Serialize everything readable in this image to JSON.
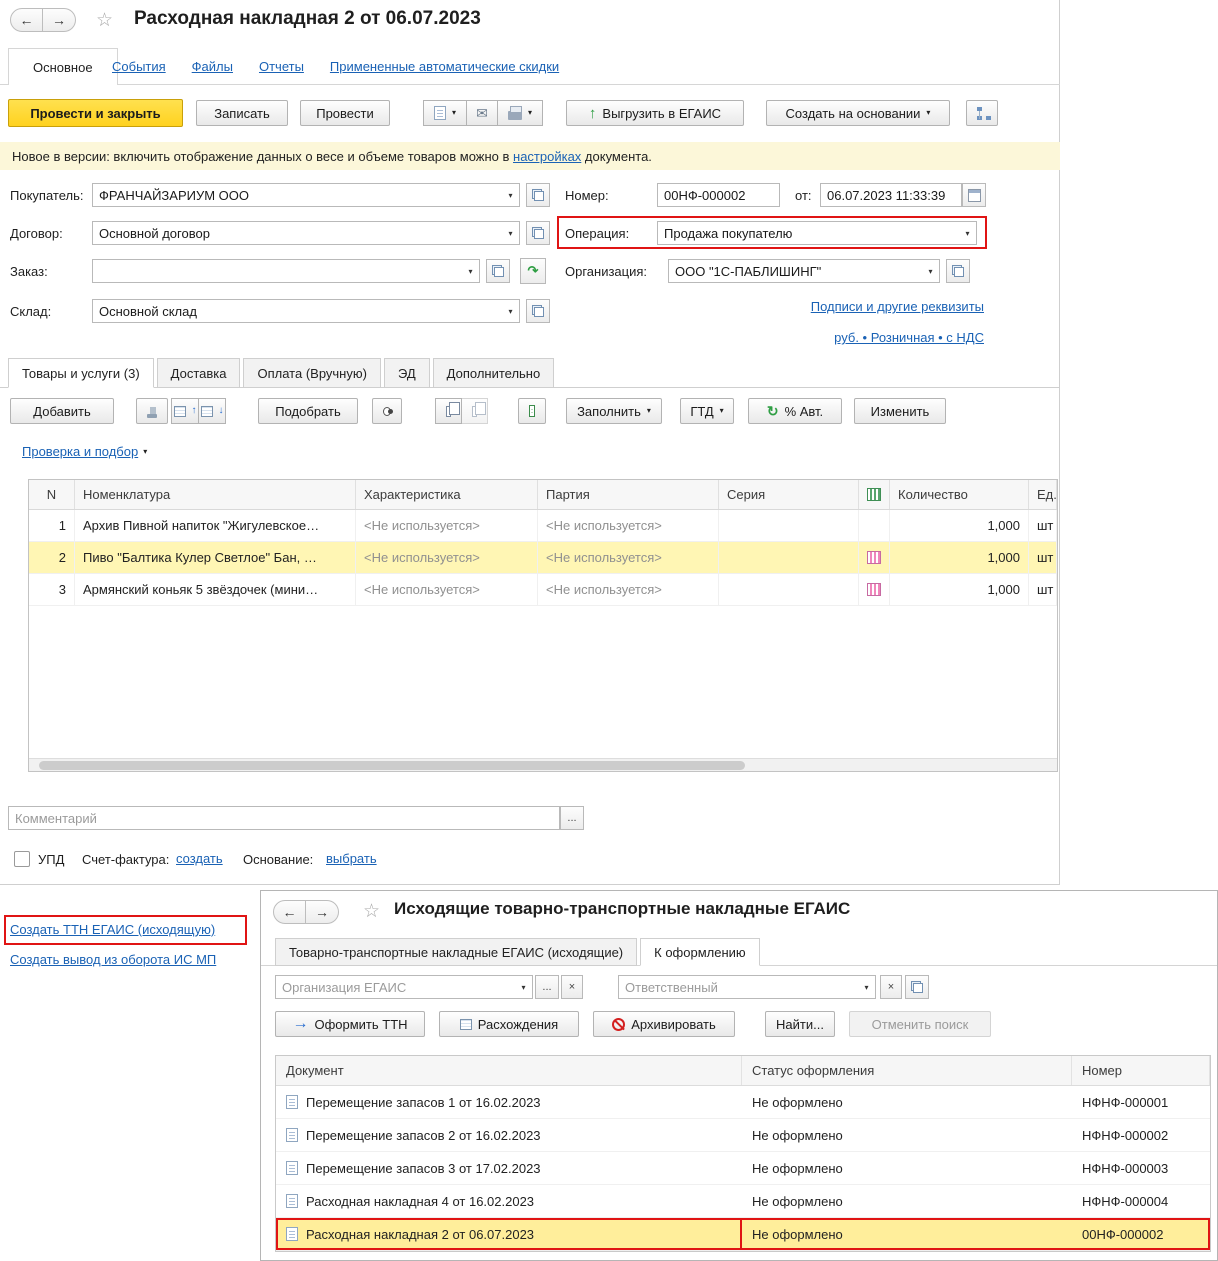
{
  "glyphs": {
    "back": "←",
    "forward": "→",
    "star": "☆",
    "caret": "▾",
    "dots": "...",
    "clear": "×",
    "up_arrow": "↑",
    "right_arrow": "→",
    "refresh": "↻",
    "envelope": "✉",
    "up_small": "↑",
    "down_small": "↓",
    "green_arrow": "↷"
  },
  "colors": {
    "highlight_red": "#e01414",
    "selected_goods_row": "#fff6b4",
    "selected_egais_row": "#ffee9b",
    "primary_button_yellow": "#ffd21f",
    "link_blue": "#1a62b5",
    "notice_bg": "#fcf7d9"
  },
  "main_window": {
    "title": "Расходная накладная 2 от 06.07.2023",
    "nav_tabs": {
      "active": "Основное",
      "links": [
        "События",
        "Файлы",
        "Отчеты",
        "Примененные автоматические скидки"
      ]
    },
    "toolbar": {
      "post_and_close": "Провести и закрыть",
      "save": "Записать",
      "post": "Провести",
      "upload_egais": "Выгрузить в ЕГАИС",
      "create_based_on": "Создать на основании"
    },
    "notice": {
      "before": "Новое в версии: включить отображение данных о весе и объеме товаров можно в ",
      "link": "настройках",
      "after": " документа."
    },
    "fields": {
      "buyer": {
        "label": "Покупатель:",
        "value": "ФРАНЧАЙЗАРИУМ ООО"
      },
      "contract": {
        "label": "Договор:",
        "value": "Основной договор"
      },
      "order": {
        "label": "Заказ:",
        "value": ""
      },
      "warehouse": {
        "label": "Склад:",
        "value": "Основной склад"
      },
      "number": {
        "label": "Номер:",
        "value": "00НФ-000002"
      },
      "date": {
        "label": "от:",
        "value": "06.07.2023 11:33:39"
      },
      "operation": {
        "label": "Операция:",
        "value": "Продажа покупателю"
      },
      "organization": {
        "label": "Организация:",
        "value": "ООО \"1С-ПАБЛИШИНГ\""
      }
    },
    "links": {
      "signatures": "Подписи и другие реквизиты",
      "currency": "руб. • Розничная • с НДС"
    },
    "section_tabs": {
      "active": "Товары и услуги (3)",
      "others": [
        "Доставка",
        "Оплата (Вручную)",
        "ЭД",
        "Дополнительно"
      ]
    },
    "goods_toolbar": {
      "add": "Добавить",
      "pick": "Подобрать",
      "fill": "Заполнить",
      "gtd": "ГТД",
      "auto_pct": "% Авт.",
      "edit": "Изменить",
      "check_link": "Проверка и подбор"
    },
    "goods_table": {
      "columns": {
        "n": "N",
        "nomenclature": "Номенклатура",
        "characteristic": "Характеристика",
        "batch": "Партия",
        "series": "Серия",
        "quantity": "Количество",
        "unit": "Ед."
      },
      "rows": [
        {
          "n": "1",
          "name": "Архив Пивной напиток \"Жигулевское…",
          "characteristic": "<Не используется>",
          "batch": "<Не используется>",
          "series": "",
          "quantity": "1,000",
          "unit": "шт"
        },
        {
          "n": "2",
          "name": "Пиво \"Балтика Кулер Светлое\" Бан, …",
          "characteristic": "<Не используется>",
          "batch": "<Не используется>",
          "series": "",
          "quantity": "1,000",
          "unit": "шт"
        },
        {
          "n": "3",
          "name": "Армянский коньяк 5 звёздочек (мини…",
          "characteristic": "<Не используется>",
          "batch": "<Не используется>",
          "series": "",
          "quantity": "1,000",
          "unit": "шт"
        }
      ]
    },
    "comment": {
      "placeholder": "Комментарий"
    },
    "footer": {
      "upd": "УПД",
      "invoice_label": "Счет-фактура:",
      "invoice_link": "создать",
      "basis_label": "Основание:",
      "basis_link": "выбрать"
    }
  },
  "side_links": {
    "create_ttn": "Создать ТТН ЕГАИС (исходящую)",
    "create_withdrawal": "Создать вывод из оборота ИС МП"
  },
  "egais_window": {
    "title": "Исходящие товарно-транспортные накладные ЕГАИС",
    "tabs": {
      "inactive": "Товарно-транспортные накладные ЕГАИС (исходящие)",
      "active": "К оформлению"
    },
    "filters": {
      "organization_placeholder": "Организация ЕГАИС",
      "responsible_placeholder": "Ответственный"
    },
    "toolbar": {
      "issue_ttn": "Оформить ТТН",
      "discrepancies": "Расхождения",
      "archive": "Архивировать",
      "find": "Найти...",
      "cancel_search": "Отменить поиск"
    },
    "table": {
      "columns": {
        "document": "Документ",
        "status": "Статус оформления",
        "number": "Номер"
      },
      "rows": [
        {
          "document": "Перемещение запасов 1 от 16.02.2023",
          "status": "Не оформлено",
          "number": "НФНФ-000001"
        },
        {
          "document": "Перемещение запасов 2 от 16.02.2023",
          "status": "Не оформлено",
          "number": "НФНФ-000002"
        },
        {
          "document": "Перемещение запасов 3 от 17.02.2023",
          "status": "Не оформлено",
          "number": "НФНФ-000003"
        },
        {
          "document": "Расходная накладная 4 от 16.02.2023",
          "status": "Не оформлено",
          "number": "НФНФ-000004"
        },
        {
          "document": "Расходная накладная 2 от 06.07.2023",
          "status": "Не оформлено",
          "number": "00НФ-000002"
        }
      ]
    }
  }
}
